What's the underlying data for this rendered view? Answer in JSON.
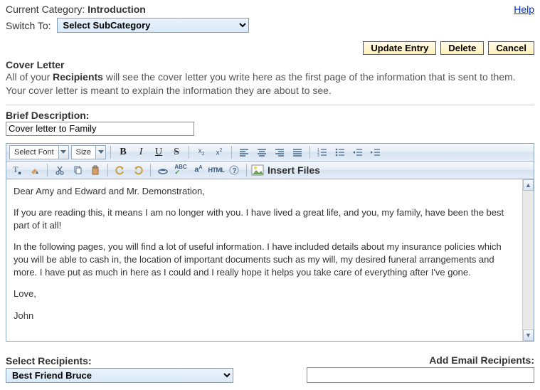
{
  "header": {
    "current_category_label": "Current Category:",
    "current_category_value": "Introduction",
    "help_link": "Help",
    "switch_to_label": "Switch To:",
    "subcategory_placeholder": "Select SubCategory"
  },
  "actions": {
    "update": "Update Entry",
    "delete": "Delete",
    "cancel": "Cancel"
  },
  "cover_letter": {
    "title": "Cover Letter",
    "desc_prefix": "All of your ",
    "desc_bold": "Recipients",
    "desc_suffix": " will see the cover letter you write here as the first page of the information that is sent to them. Your cover letter is meant to explain the information they are about to see."
  },
  "brief": {
    "label": "Brief Description:",
    "value": "Cover letter to Family"
  },
  "toolbar": {
    "font_combo": "Select Font",
    "size_combo": "Size",
    "insert_files": "Insert Files",
    "html_label": "HTML"
  },
  "editor": {
    "p1": "Dear Amy and Edward and Mr. Demonstration,",
    "p2": "If you are reading this, it means I am no longer with you. I have lived a great life, and you, my family, have been the best part of it all!",
    "p3": "In the following pages, you will find a lot of useful information. I have included details about my insurance policies which you will be able to cash in, the location of important documents such as my will, my desired funeral arrangements and more. I have put as much in here as I could and I really hope it helps you take care of everything after I've gone.",
    "p4": "Love,",
    "p5": "John"
  },
  "recipients": {
    "select_label": "Select Recipients:",
    "add_email_label": "Add Email Recipients:",
    "selected_option": "Best Friend Bruce"
  }
}
